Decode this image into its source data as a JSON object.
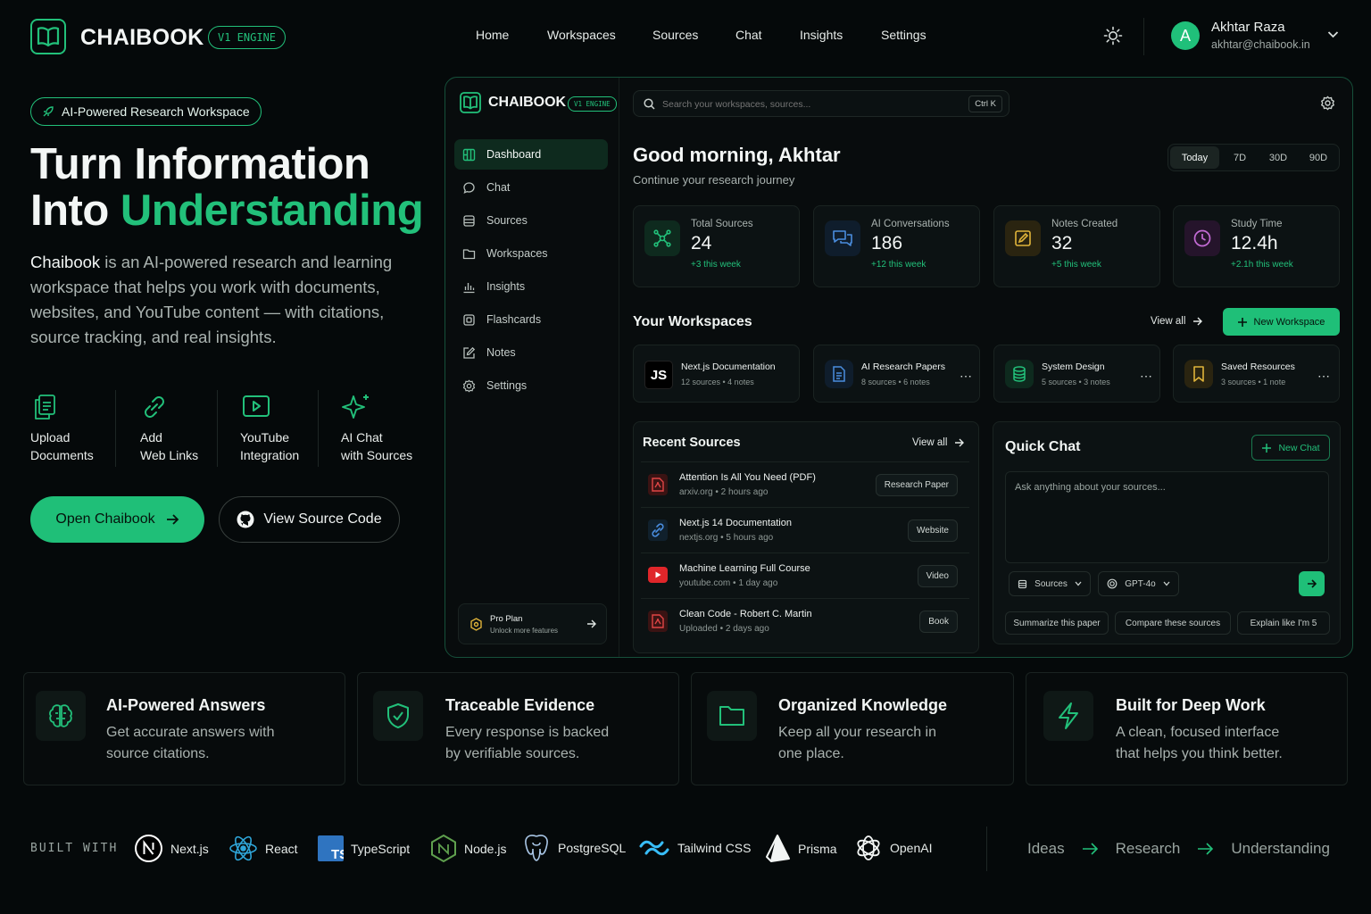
{
  "brand": {
    "name": "CHAIBOOK",
    "engine": "V1 ENGINE"
  },
  "nav": {
    "items": [
      "Home",
      "Workspaces",
      "Sources",
      "Chat",
      "Insights",
      "Settings"
    ]
  },
  "user": {
    "initial": "A",
    "name": "Akhtar Raza",
    "email": "akhtar@chaibook.in"
  },
  "hero": {
    "badge": "AI-Powered Research Workspace",
    "title_line1": "Turn Information",
    "title_line2_a": "Into ",
    "title_line2_b": "Understanding",
    "lead_brand": "Chaibook",
    "lead_rest": " is an AI-powered research and learning workspace that helps you work with documents, websites, and YouTube content — with citations, source tracking, and real insights.",
    "features": [
      {
        "icon": "upload-documents-icon",
        "line1": "Upload",
        "line2": "Documents"
      },
      {
        "icon": "link-icon",
        "line1": "Add",
        "line2": "Web Links"
      },
      {
        "icon": "youtube-play-icon",
        "line1": "YouTube",
        "line2": "Integration"
      },
      {
        "icon": "sparkle-icon",
        "line1": "AI Chat",
        "line2": "with Sources"
      }
    ],
    "primary_button": "Open Chaibook",
    "secondary_button": "View Source Code"
  },
  "app": {
    "brand": "CHAIBOOK",
    "engine": "V1 ENGINE",
    "search_placeholder": "Search your workspaces, sources...",
    "search_shortcut": "Ctrl K",
    "sidebar": [
      "Dashboard",
      "Chat",
      "Sources",
      "Workspaces",
      "Insights",
      "Flashcards",
      "Notes",
      "Settings"
    ],
    "pro": {
      "title": "Pro Plan",
      "subtitle": "Unlock more features"
    },
    "greeting": "Good morning, Akhtar",
    "greeting_sub": "Continue your research journey",
    "ranges": [
      "Today",
      "7D",
      "30D",
      "90D"
    ],
    "stats": [
      {
        "label": "Total Sources",
        "value": "24",
        "delta": "+3 this week",
        "color": "#22c07a"
      },
      {
        "label": "AI Conversations",
        "value": "186",
        "delta": "+12 this week",
        "color": "#4a8dde"
      },
      {
        "label": "Notes Created",
        "value": "32",
        "delta": "+5 this week",
        "color": "#e0b43a"
      },
      {
        "label": "Study Time",
        "value": "12.4h",
        "delta": "+2.1h this week",
        "color": "#c46bd6"
      }
    ],
    "workspaces_title": "Your Workspaces",
    "view_all": "View all",
    "new_workspace": "New Workspace",
    "workspaces": [
      {
        "badge": "JS",
        "name": "Next.js Documentation",
        "meta": "12 sources • 4 notes"
      },
      {
        "name": "AI Research Papers",
        "meta": "8 sources • 6 notes"
      },
      {
        "name": "System Design",
        "meta": "5 sources • 3 notes"
      },
      {
        "name": "Saved Resources",
        "meta": "3 sources • 1 note"
      }
    ],
    "recent_title": "Recent Sources",
    "recent": [
      {
        "title": "Attention Is All You Need (PDF)",
        "source": "arxiv.org",
        "time": "2 hours ago",
        "tag": "Research Paper"
      },
      {
        "title": "Next.js 14 Documentation",
        "source": "nextjs.org",
        "time": "5 hours ago",
        "tag": "Website"
      },
      {
        "title": "Machine Learning Full Course",
        "source": "youtube.com",
        "time": "1 day ago",
        "tag": "Video"
      },
      {
        "title": "Clean Code - Robert C. Martin",
        "source": "Uploaded",
        "time": "2 days ago",
        "tag": "Book"
      }
    ],
    "quick_chat": {
      "title": "Quick Chat",
      "new_chat": "New Chat",
      "placeholder": "Ask anything about your sources...",
      "sources_select": "Sources",
      "model_select": "GPT-4o",
      "suggestions": [
        "Summarize this paper",
        "Compare these sources",
        "Explain like I'm 5"
      ]
    }
  },
  "benefits": [
    {
      "icon": "brain-icon",
      "title": "AI-Powered Answers",
      "line1": "Get accurate answers with",
      "line2": "source citations."
    },
    {
      "icon": "shield-check-icon",
      "title": "Traceable Evidence",
      "line1": "Every response is backed",
      "line2": "by verifiable sources."
    },
    {
      "icon": "folder-icon",
      "title": "Organized Knowledge",
      "line1": "Keep all your research in",
      "line2": "one place."
    },
    {
      "icon": "lightning-icon",
      "title": "Built for Deep Work",
      "line1": "A clean, focused interface",
      "line2": "that helps you think better."
    }
  ],
  "built_with": {
    "label": "BUILT WITH",
    "items": [
      "Next.js",
      "React",
      "TypeScript",
      "Node.js",
      "PostgreSQL",
      "Tailwind CSS",
      "Prisma",
      "OpenAI"
    ]
  },
  "flow": [
    "Ideas",
    "Research",
    "Understanding"
  ]
}
